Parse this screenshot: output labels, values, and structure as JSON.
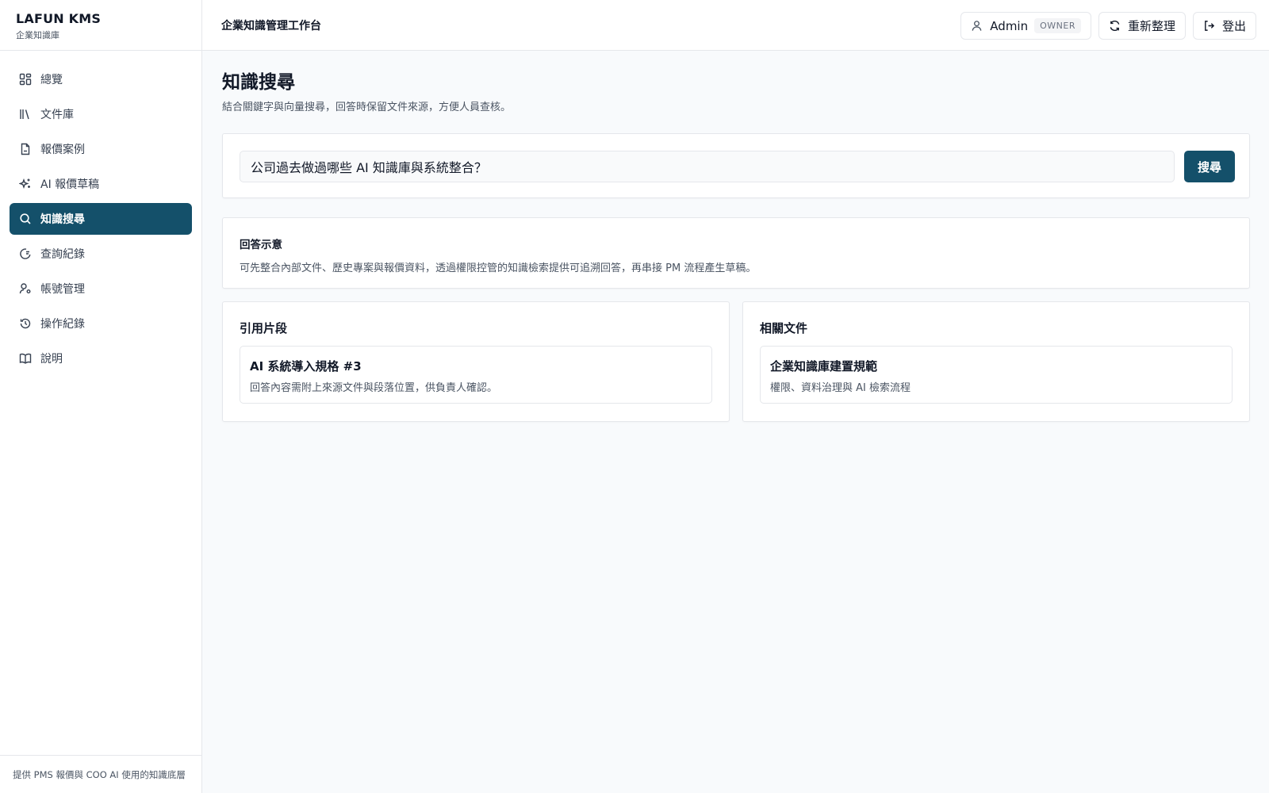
{
  "brand": {
    "title": "LAFUN KMS",
    "subtitle": "企業知識庫"
  },
  "sidebar": {
    "items": [
      {
        "label": "總覽",
        "icon": "dashboard-icon",
        "active": false
      },
      {
        "label": "文件庫",
        "icon": "library-icon",
        "active": false
      },
      {
        "label": "報價案例",
        "icon": "file-icon",
        "active": false
      },
      {
        "label": "AI 報價草稿",
        "icon": "sparkles-icon",
        "active": false
      },
      {
        "label": "知識搜尋",
        "icon": "search-icon",
        "active": true
      },
      {
        "label": "查詢紀錄",
        "icon": "query-log-icon",
        "active": false
      },
      {
        "label": "帳號管理",
        "icon": "user-settings-icon",
        "active": false
      },
      {
        "label": "操作紀錄",
        "icon": "history-icon",
        "active": false
      },
      {
        "label": "說明",
        "icon": "book-icon",
        "active": false
      }
    ],
    "footer": "提供 PMS 報價與 COO AI 使用的知識底層"
  },
  "topbar": {
    "title": "企業知識管理工作台",
    "user": {
      "name": "Admin",
      "role": "OWNER",
      "icon": "user-icon"
    },
    "refresh_label": "重新整理",
    "logout_label": "登出"
  },
  "main": {
    "title": "知識搜尋",
    "description": "結合關鍵字與向量搜尋，回答時保留文件來源，方便人員查核。",
    "search": {
      "value": "公司過去做過哪些 AI 知識庫與系統整合？",
      "button_label": "搜尋"
    },
    "answer": {
      "title": "回答示意",
      "text": "可先整合內部文件、歷史專案與報價資料，透過權限控管的知識檢索提供可追溯回答，再串接 PM 流程產生草稿。"
    },
    "citations": {
      "title": "引用片段",
      "items": [
        {
          "title": "AI 系統導入規格 #3",
          "desc": "回答內容需附上來源文件與段落位置，供負責人確認。"
        }
      ]
    },
    "related": {
      "title": "相關文件",
      "items": [
        {
          "title": "企業知識庫建置規範",
          "desc": "權限、資料治理與 AI 檢索流程"
        }
      ]
    }
  },
  "colors": {
    "primary": "#14506a",
    "border": "#e5e7eb",
    "background": "#f8fafc"
  }
}
